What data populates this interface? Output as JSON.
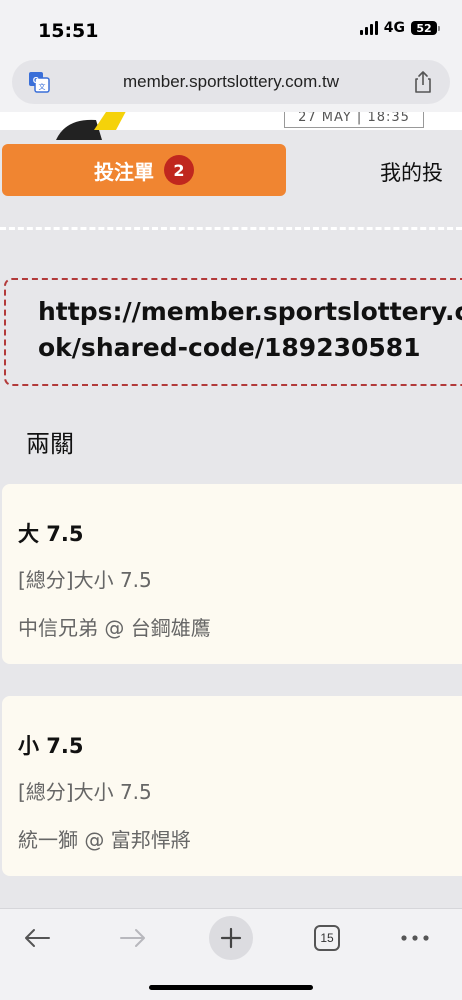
{
  "status_bar": {
    "time": "15:51",
    "network": "4G",
    "battery": "52"
  },
  "address_bar": {
    "url": "member.sportslottery.com.tw",
    "translate_icon": "translate-icon",
    "share_icon": "share-icon"
  },
  "hero": {
    "date": "27 MAY | 18:35"
  },
  "tabs": {
    "active_label": "投注單",
    "active_badge": "2",
    "other_label": "我的投"
  },
  "share": {
    "url_line1": "https://member.sportslottery.co",
    "url_line2": "ok/shared-code/189230581"
  },
  "bet_type": "兩關",
  "bets": [
    {
      "selection": "大 7.5",
      "market": "[總分]大小 7.5",
      "match": "中信兄弟 @ 台鋼雄鷹"
    },
    {
      "selection": "小 7.5",
      "market": "[總分]大小 7.5",
      "match": "統一獅 @ 富邦悍將"
    }
  ],
  "toolbar": {
    "tab_count": "15",
    "icons": [
      "back-arrow-icon",
      "forward-arrow-icon",
      "plus-icon",
      "tabs-icon",
      "more-icon"
    ]
  },
  "colors": {
    "accent": "#f08531",
    "badge": "#c0271e",
    "card_bg": "#fdfaf1",
    "dashed_border": "#b23a3a"
  }
}
